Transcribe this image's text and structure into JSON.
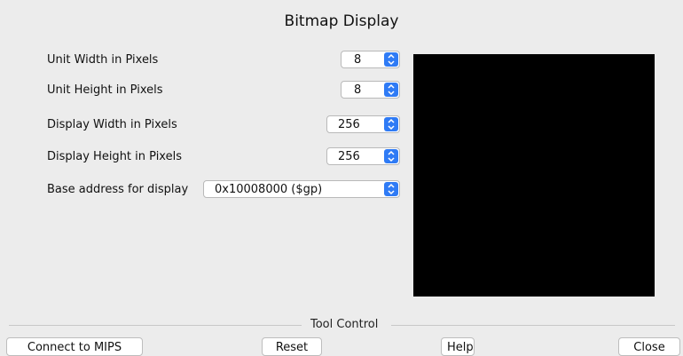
{
  "title": "Bitmap Display",
  "settings": [
    {
      "label": "Unit Width in Pixels",
      "value": "8"
    },
    {
      "label": "Unit Height in Pixels",
      "value": "8"
    },
    {
      "label": "Display Width in Pixels",
      "value": "256"
    },
    {
      "label": "Display Height in Pixels",
      "value": "256"
    },
    {
      "label": "Base address for display",
      "value": "0x10008000 ($gp)"
    }
  ],
  "tool_control": {
    "title": "Tool Control",
    "buttons": [
      "Connect to MIPS",
      "Reset",
      "Help",
      "Close"
    ]
  },
  "colors": {
    "accent": "#2f7bf5",
    "canvas": "#000000",
    "background": "#ececec"
  },
  "icons": {
    "dropdown": "chevron-up-down-icon"
  }
}
